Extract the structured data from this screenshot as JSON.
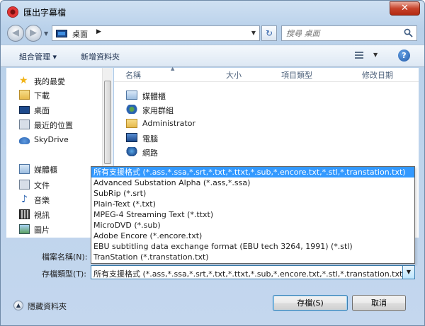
{
  "window": {
    "title": "匯出字幕檔",
    "close_glyph": "✕"
  },
  "address": {
    "back_glyph": "◀",
    "forward_glyph": "▶",
    "location": "桌面",
    "separator_glyph": "▶",
    "refresh_glyph": "↻",
    "search_placeholder": "搜尋 桌面"
  },
  "toolbar": {
    "organize_label": "組合管理 ▾",
    "new_folder_label": "新增資料夾",
    "view_drop_glyph": "▼",
    "help_glyph": "?"
  },
  "nav": {
    "favorites": [
      {
        "label": "我的最愛",
        "icon": "star-icon"
      },
      {
        "label": "下載",
        "icon": "download-folder-icon"
      },
      {
        "label": "桌面",
        "icon": "desktop-icon"
      },
      {
        "label": "最近的位置",
        "icon": "recent-places-icon"
      },
      {
        "label": "SkyDrive",
        "icon": "skydrive-icon"
      }
    ],
    "libraries": [
      {
        "label": "媒體櫃",
        "icon": "libraries-icon"
      },
      {
        "label": "文件",
        "icon": "documents-icon"
      },
      {
        "label": "音樂",
        "icon": "music-icon"
      },
      {
        "label": "視訊",
        "icon": "video-icon"
      },
      {
        "label": "圖片",
        "icon": "pictures-icon"
      }
    ]
  },
  "columns": {
    "name": "名稱",
    "size": "大小",
    "type": "項目類型",
    "modified": "修改日期"
  },
  "files": [
    {
      "label": "媒體櫃",
      "icon": "libraries-icon"
    },
    {
      "label": "家用群組",
      "icon": "homegroup-icon"
    },
    {
      "label": "Administrator",
      "icon": "user-folder-icon"
    },
    {
      "label": "電腦",
      "icon": "computer-icon"
    },
    {
      "label": "網路",
      "icon": "network-icon"
    }
  ],
  "dropdown_options": [
    "所有支援格式 (*.ass,*.ssa,*.srt,*.txt,*.ttxt,*.sub,*.encore.txt,*.stl,*.transtation.txt)",
    "Advanced Substation Alpha (*.ass,*.ssa)",
    "SubRip (*.srt)",
    "Plain-Text (*.txt)",
    "MPEG-4 Streaming Text (*.ttxt)",
    "MicroDVD (*.sub)",
    "Adobe Encore (*.encore.txt)",
    "EBU subtitling data exchange format (EBU tech 3264, 1991) (*.stl)",
    "TranStation (*.transtation.txt)"
  ],
  "form": {
    "filename_label": "檔案名稱(N):",
    "filetype_label": "存檔類型(T):",
    "filetype_value": "所有支援格式 (*.ass,*.ssa,*.srt,*.txt,*.ttxt,*.sub,*.encore.txt,*.stl,*.transtation.txt)",
    "select_arrow_glyph": "▼"
  },
  "footer": {
    "hide_folders_label": "隱藏資料夾",
    "hide_glyph": "▲",
    "save_label": "存檔(S)",
    "cancel_label": "取消"
  },
  "colors": {
    "selection": "#3399ff",
    "frame": "#b9d1ea"
  }
}
